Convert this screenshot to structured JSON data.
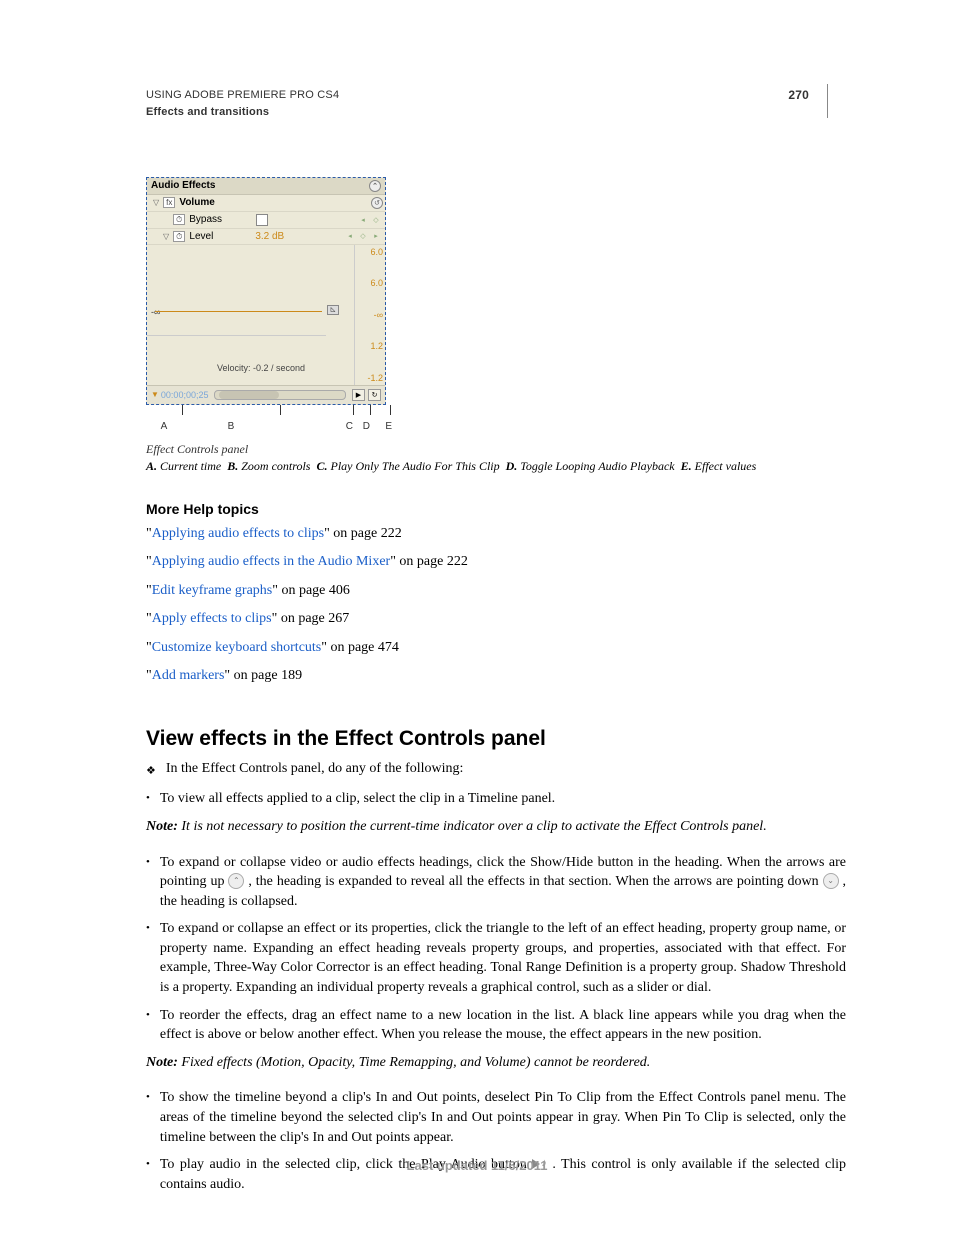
{
  "header": {
    "title": "USING ADOBE PREMIERE PRO CS4",
    "section": "Effects and transitions",
    "page_number": "270"
  },
  "figure": {
    "panel_title": "Audio Effects",
    "volume_label": "Volume",
    "bypass_label": "Bypass",
    "level_label": "Level",
    "level_value": "3.2 dB",
    "scale_top": "6.0",
    "scale_mid": "6.0",
    "neg_inf": "-∞",
    "r1": "1.2",
    "r2": "-1.2",
    "velocity": "Velocity: -0.2 / second",
    "current_time": "00:00;00;25",
    "callouts": {
      "A": "A",
      "B": "B",
      "C": "C",
      "D": "D",
      "E": "E"
    },
    "caption": "Effect Controls panel",
    "legend": [
      {
        "key": "A.",
        "text": "Current time"
      },
      {
        "key": "B.",
        "text": "Zoom controls"
      },
      {
        "key": "C.",
        "text": "Play Only The Audio For This Clip"
      },
      {
        "key": "D.",
        "text": "Toggle Looping Audio Playback"
      },
      {
        "key": "E.",
        "text": "Effect values"
      }
    ]
  },
  "more_help": {
    "heading": "More Help topics",
    "links": [
      {
        "text": "Applying audio effects to clips",
        "suffix": "\" on page 222"
      },
      {
        "text": "Applying audio effects in the Audio Mixer",
        "suffix": "\" on page 222"
      },
      {
        "text": "Edit keyframe graphs",
        "suffix": "\" on page 406"
      },
      {
        "text": "Apply effects to clips",
        "suffix": "\" on page 267"
      },
      {
        "text": "Customize keyboard shortcuts",
        "suffix": "\" on page 474"
      },
      {
        "text": "Add markers",
        "suffix": "\" on page 189"
      }
    ]
  },
  "section2": {
    "heading": "View effects in the Effect Controls panel",
    "intro": "In the Effect Controls panel, do any of the following:",
    "bullets1": [
      "To view all effects applied to a clip, select the clip in a Timeline panel."
    ],
    "note1_label": "Note:",
    "note1_text": " It is not necessary to position the current-time indicator over a clip to activate the Effect Controls panel.",
    "bullets2": [
      "To expand or collapse video or audio effects headings, click the Show/Hide button in the heading. When the arrows are pointing up ",
      " , the heading is expanded to reveal all the effects in that section. When the arrows are pointing down ",
      " , the heading is collapsed."
    ],
    "bullets3": [
      "To expand or collapse an effect or its properties, click the triangle to the left of an effect heading, property group name, or property name. Expanding an effect heading reveals property groups, and properties, associated with that effect. For example, Three-Way Color Corrector is an effect heading. Tonal Range Definition is a property group. Shadow Threshold is a property. Expanding an individual property reveals a graphical control, such as a slider or dial.",
      "To reorder the effects, drag an effect name to a new location in the list. A black line appears while you drag when the effect is above or below another effect. When you release the mouse, the effect appears in the new position."
    ],
    "note2_label": "Note:",
    "note2_text": " Fixed effects (Motion, Opacity, Time Remapping, and Volume) cannot be reordered.",
    "bullets4": [
      "To show the timeline beyond a clip's In and Out points, deselect Pin To Clip from the Effect Controls panel menu. The areas of the timeline beyond the selected clip's In and Out points appear in gray. When Pin To Clip is selected, only the timeline between the clip's In and Out points appear.",
      "To play audio in the selected clip, click the Play Audio button ",
      " . This control is only available if the selected clip contains audio."
    ]
  },
  "footer": {
    "text": "Last updated 11/6/2011"
  }
}
